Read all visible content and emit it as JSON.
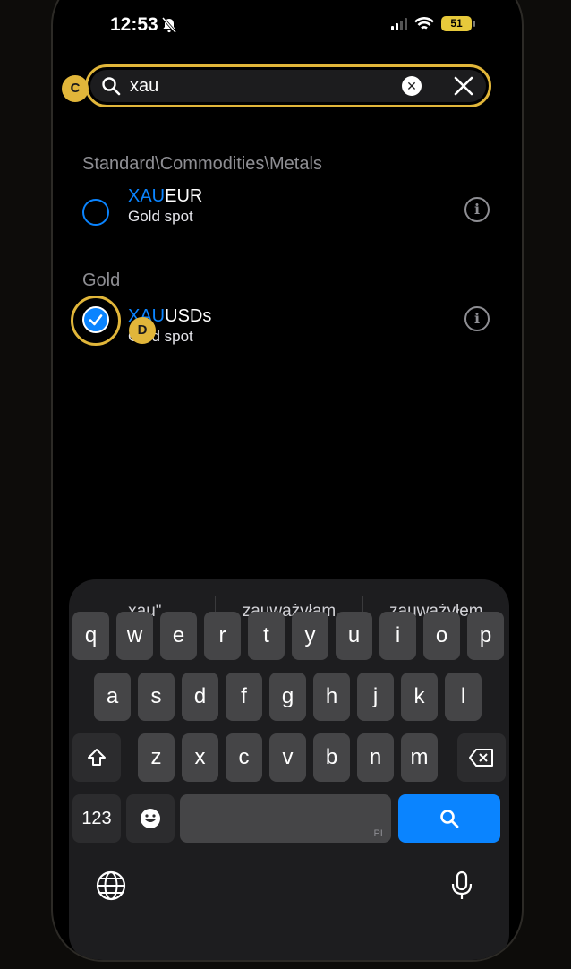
{
  "status": {
    "time": "12:53",
    "battery": "51"
  },
  "search": {
    "value": "xau",
    "placeholder": ""
  },
  "badges": {
    "c": "C",
    "d": "D"
  },
  "sections": [
    {
      "header": "Standard\\Commodities\\Metals",
      "item": {
        "highlight": "XAU",
        "rest": "EUR",
        "desc": "Gold spot",
        "selected": false
      }
    },
    {
      "header": "Gold",
      "item": {
        "highlight": "XAU",
        "rest": "USDs",
        "desc": "Gold spot",
        "selected": true
      }
    }
  ],
  "keyboard": {
    "suggestions": [
      "„xau\"",
      "zauważyłam",
      "zauważyłem"
    ],
    "row1": [
      "q",
      "w",
      "e",
      "r",
      "t",
      "y",
      "u",
      "i",
      "o",
      "p"
    ],
    "row2": [
      "a",
      "s",
      "d",
      "f",
      "g",
      "h",
      "j",
      "k",
      "l"
    ],
    "row3": [
      "z",
      "x",
      "c",
      "v",
      "b",
      "n",
      "m"
    ],
    "numbers_label": "123",
    "space_hint": "PL"
  },
  "colors": {
    "accent": "#0a84ff",
    "highlight": "#e1b63a"
  }
}
